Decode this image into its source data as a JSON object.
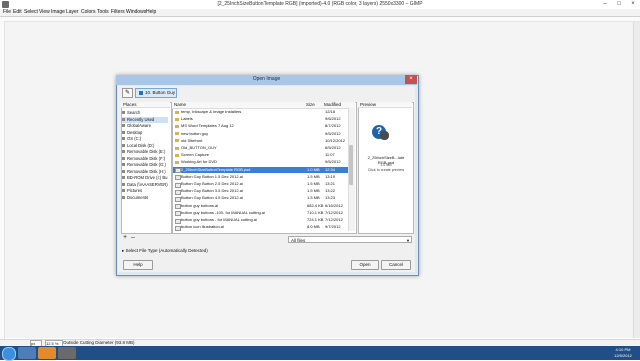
{
  "window": {
    "title": "[2_25InchSizeButtonTemplate RGB] (imported)-4.0 (RGB color, 3 layers) 2550x3300 – GIMP",
    "controls": {
      "minimize": "–",
      "maximize": "□",
      "close": "×"
    }
  },
  "menu": [
    "File",
    "Edit",
    "Select",
    "View",
    "Image",
    "Layer",
    "Colors",
    "Tools",
    "Filters",
    "Windows",
    "Help"
  ],
  "dialog": {
    "title": "Open Image",
    "close": "×",
    "path_crumb": "10. Button Guy",
    "places_header": "Places",
    "places": [
      "Search",
      "Recently Used",
      "GlobalAware",
      "Desktop",
      "OS (C:)",
      "Local Disk (D:)",
      "Removable Disk (E:)",
      "Removable Disk (F:)",
      "Removable Disk (G:)",
      "Removable Disk (H:)",
      "BD-ROM Drive (I:) Bu",
      "Data (\\\\AAASERVER)",
      "Pictures",
      "Documents"
    ],
    "places_selected": 1,
    "add_label": "+",
    "remove_label": "–",
    "files_header": {
      "name": "Name",
      "size": "Size",
      "modified": "Modified"
    },
    "files": [
      {
        "name": "temp, Inkscape & Image Installers",
        "size": "",
        "modified": "12/18",
        "type": "folder"
      },
      {
        "name": "Labels",
        "size": "",
        "modified": "9/6/2012",
        "type": "folder"
      },
      {
        "name": "MS Word Templates 7 Aug 12",
        "size": "",
        "modified": "8/7/2012",
        "type": "folder"
      },
      {
        "name": "new button guy",
        "size": "",
        "modified": "9/5/2012",
        "type": "folder"
      },
      {
        "name": "old Sitefront",
        "size": "",
        "modified": "10/12/2012",
        "type": "folder"
      },
      {
        "name": "Old_BUTTON_GUY",
        "size": "",
        "modified": "6/5/2012",
        "type": "folder"
      },
      {
        "name": "Screen Capture",
        "size": "",
        "modified": "11:07",
        "type": "folder"
      },
      {
        "name": "Working Art for DVD",
        "size": "",
        "modified": "9/5/2012",
        "type": "folder"
      },
      {
        "name": "2_25InchSizeButtonTemplate RGB.psd",
        "size": "1.0 MB",
        "modified": "12:34",
        "type": "file"
      },
      {
        "name": "Button Guy Button 1.5 Dec 2012.ai",
        "size": "1.5 MB",
        "modified": "13:19",
        "type": "file"
      },
      {
        "name": "Button Guy Button 2.5 Dec 2012.ai",
        "size": "1.5 MB",
        "modified": "13:21",
        "type": "file"
      },
      {
        "name": "Button Guy Button 3.5 Dec 2012.ai",
        "size": "1.5 MB",
        "modified": "13:22",
        "type": "file"
      },
      {
        "name": "Button Guy Button 4.5 Dec 2012.ai",
        "size": "1.5 MB",
        "modified": "13:23",
        "type": "file"
      },
      {
        "name": "button guy buttons.ai",
        "size": "682.4 KB",
        "modified": "6/16/2012",
        "type": "file"
      },
      {
        "name": "button guy buttons -100- for MANUAL cutting.ai",
        "size": "710.1 KB",
        "modified": "7/12/2012",
        "type": "file"
      },
      {
        "name": "button guy buttons - for MANUAL cutting.ai",
        "size": "724.1 KB",
        "modified": "7/12/2012",
        "type": "file"
      },
      {
        "name": "button icon illustration.ai",
        "size": "8.0 MB",
        "modified": "9/7/2012",
        "type": "file"
      }
    ],
    "files_selected": 8,
    "preview_header": "Preview",
    "preview_name": "2_25InchSizeB...lute RGB.psd",
    "preview_info": "1.0 MB\nClick to create preview",
    "filetype": "All files",
    "filetype_expander": "Select File Type (Automatically Detected)",
    "help_label": "Help",
    "open_label": "Open",
    "cancel_label": "Cancel"
  },
  "status": {
    "unit": "px",
    "zoom": "12.5 %",
    "text": "Outside Cutting Diameter (93.8 MB)"
  },
  "taskbar": {
    "time": "4:10 PM",
    "date": "12/5/2012"
  },
  "colors": {
    "taskbar": "#1f4f86",
    "dialog_title": "#a9c6e8",
    "selection": "#3a7ed6"
  }
}
